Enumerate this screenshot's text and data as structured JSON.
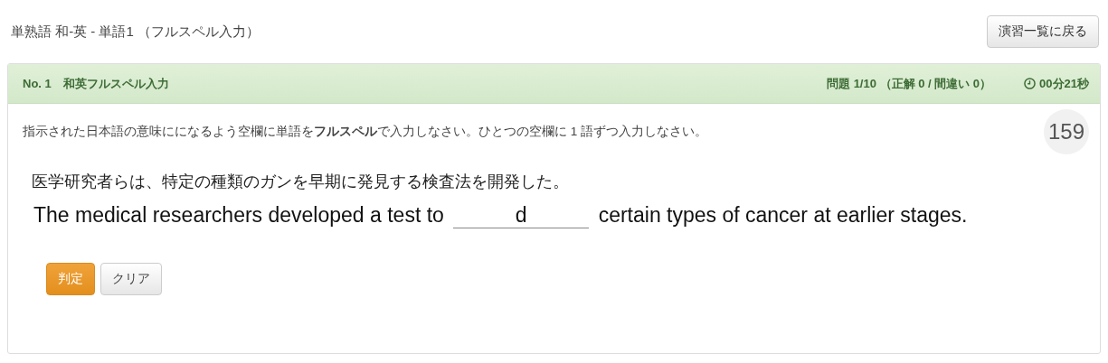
{
  "page_title": "単熟語 和-英 - 単語1 （フルスペル入力）",
  "back_button": "演習一覧に戻る",
  "question_header": {
    "number": "No. 1　和英フルスペル入力",
    "progress": "問題 1/10 （正解 0 / 間違い 0）",
    "timer": "00分21秒"
  },
  "instruction": "指示された日本語の意味にになるよう空欄に単語を**フルスペル**で入力しなさい。ひとつの空欄に 1 語ずつ入力しなさい。",
  "counter": "159",
  "japanese_sentence": "医学研究者らは、特定の種類のガンを早期に発見する検査法を開発した。",
  "english_sentence": {
    "before": "The medical researchers developed a test to",
    "answer": "d",
    "after": "certain types of cancer at earlier stages."
  },
  "buttons": [
    {
      "label": "判定",
      "kind": "primary"
    },
    {
      "label": "クリア",
      "kind": "default"
    }
  ]
}
